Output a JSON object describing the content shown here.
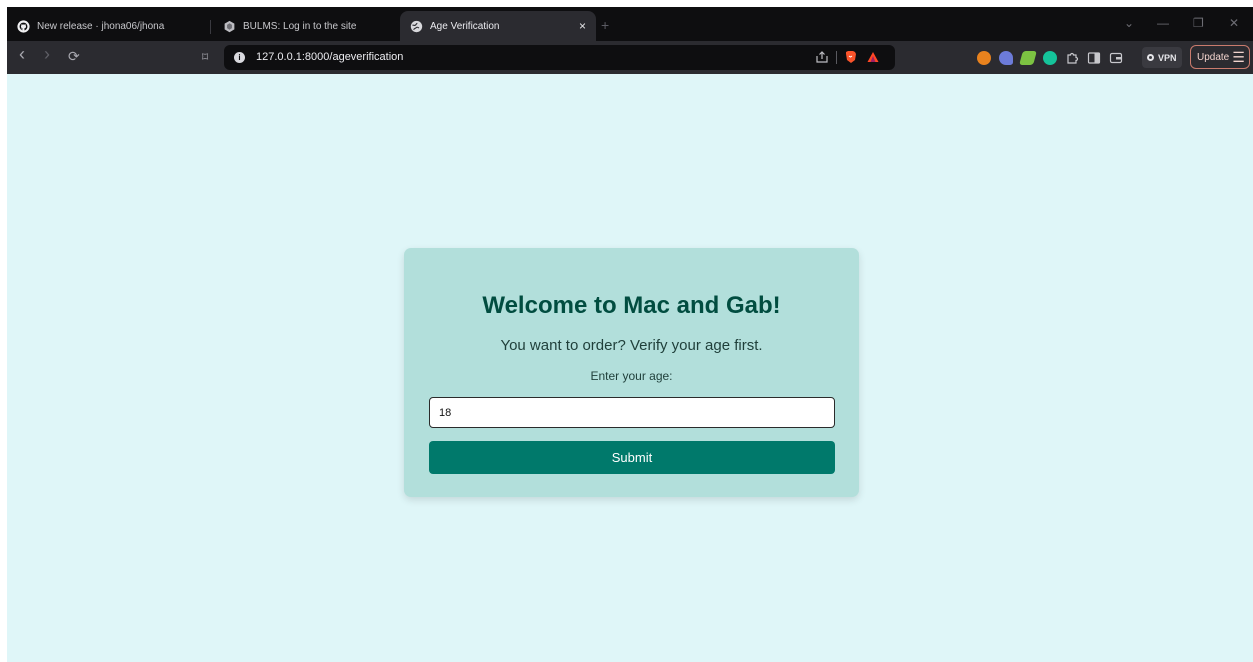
{
  "browser": {
    "tabs": [
      {
        "label": "New release · jhona06/jhona",
        "favicon": "github-icon"
      },
      {
        "label": "BULMS: Log in to the site",
        "favicon": "bulms-icon"
      },
      {
        "label": "Age Verification",
        "favicon": "globe-icon",
        "active": true
      }
    ],
    "close_glyph": "×",
    "new_tab_glyph": "+",
    "window_controls": {
      "dropdown": "⌄",
      "minimize": "—",
      "restore": "❐",
      "close": "✕"
    },
    "nav": {
      "back": "‹",
      "forward": "›",
      "reload": "⟳",
      "bookmark": "⌑"
    },
    "address": {
      "info_glyph": "i",
      "url": "127.0.0.1:8000/ageverification"
    },
    "vpn_label": "VPN",
    "update_label": "Update",
    "menu_glyph": "☰"
  },
  "page": {
    "background": "#dff6f8",
    "card_color": "#b2dfdb",
    "title": "Welcome to Mac and Gab!",
    "subtitle": "You want to order? Verify your age first.",
    "age_label": "Enter your age:",
    "age_value": "18",
    "submit_label": "Submit",
    "accent": "#00796b",
    "title_color": "#014d40"
  }
}
